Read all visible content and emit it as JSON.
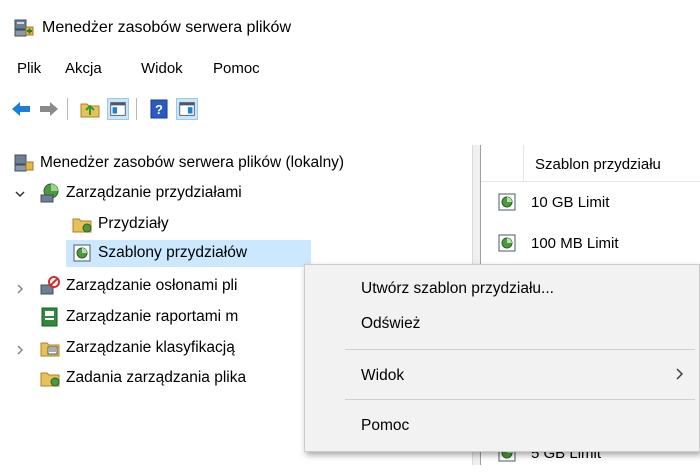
{
  "window": {
    "title": "Menedżer zasobów serwera plików"
  },
  "menubar": {
    "items": [
      "Plik",
      "Akcja",
      "Widok",
      "Pomoc"
    ]
  },
  "toolbar": {
    "buttons": [
      "back-arrow-icon",
      "forward-arrow-icon",
      "up-folder-icon",
      "show-hide-tree-icon",
      "help-icon",
      "show-hide-action-pane-icon"
    ]
  },
  "tree": {
    "root": "Menedżer zasobów serwera plików (lokalny)",
    "quota_mgmt": "Zarządzanie przydziałami",
    "quotas": "Przydziały",
    "quota_templates": "Szablony przydziałów",
    "file_screening": "Zarządzanie osłonami pli",
    "reports": "Zarządzanie raportami m",
    "classification": "Zarządzanie klasyfikacją",
    "file_mgmt_tasks": "Zadania zarządzania plika"
  },
  "list": {
    "column_header": "Szablon przydziału",
    "rows": [
      "10 GB Limit",
      "100 MB Limit",
      "5 GB Limit"
    ]
  },
  "context_menu": {
    "create_template": "Utwórz szablon przydziału...",
    "refresh": "Odśwież",
    "view": "Widok",
    "help": "Pomoc"
  },
  "colors": {
    "selection": "#cce8ff",
    "menu_bg": "#f2f2f2",
    "toolbar_blue": "#1e7fd8"
  }
}
